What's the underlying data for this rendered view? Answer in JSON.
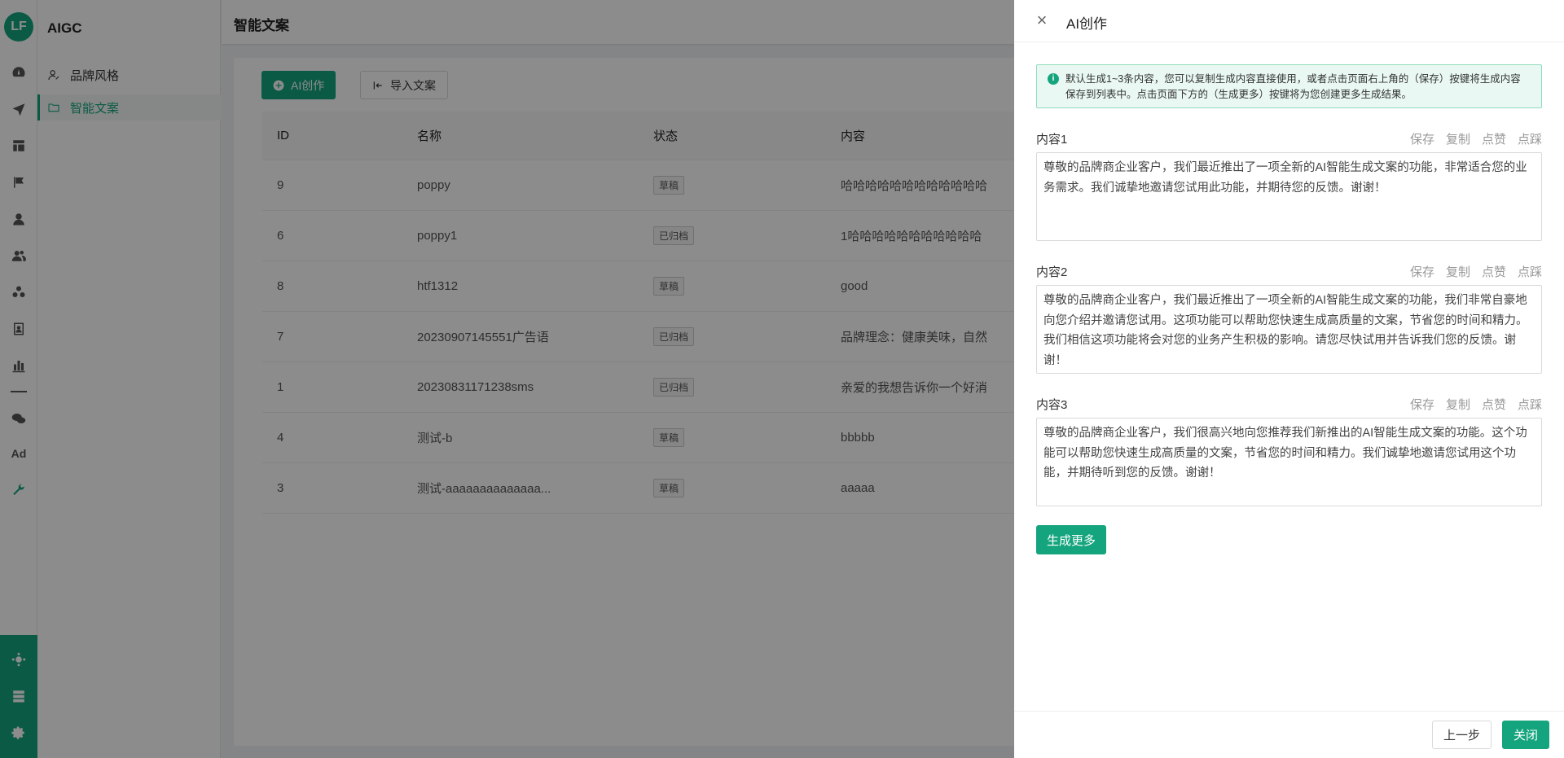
{
  "app": {
    "logo_text": "LF",
    "name": "AIGC"
  },
  "colors": {
    "accent": "#15a57e"
  },
  "rail": {
    "icons": [
      "dashboard-icon",
      "send-icon",
      "layout-icon",
      "flag-icon",
      "user-icon",
      "users-icon",
      "group-icon",
      "contact-icon",
      "bar-chart-icon",
      "link-icon",
      "wechat-icon",
      "ad-icon",
      "wrench-icon"
    ],
    "ad_label": "Ad",
    "bottom_icons": [
      "brain-icon",
      "server-icon",
      "settings-icon"
    ]
  },
  "sidemenu": {
    "items": [
      {
        "label": "品牌风格",
        "icon": "user-style-icon",
        "active": false
      },
      {
        "label": "智能文案",
        "icon": "folder-icon",
        "active": true
      }
    ]
  },
  "page": {
    "title": "智能文案",
    "toolbar": {
      "ai_create_label": "AI创作",
      "import_label": "导入文案"
    }
  },
  "table": {
    "columns": [
      "ID",
      "名称",
      "状态",
      "内容"
    ],
    "rows": [
      {
        "id": "9",
        "name": "poppy",
        "status": "草稿",
        "content": "哈哈哈哈哈哈哈哈哈哈哈哈"
      },
      {
        "id": "6",
        "name": "poppy1",
        "status": "已归档",
        "content": "1哈哈哈哈哈哈哈哈哈哈哈"
      },
      {
        "id": "8",
        "name": "htf1312",
        "status": "草稿",
        "content": "good"
      },
      {
        "id": "7",
        "name": "20230907145551广告语",
        "status": "已归档",
        "content": "品牌理念：健康美味，自然"
      },
      {
        "id": "1",
        "name": "20230831171238sms",
        "status": "已归档",
        "content": "亲爱的我想告诉你一个好消"
      },
      {
        "id": "4",
        "name": "测试-b",
        "status": "草稿",
        "content": "bbbbb"
      },
      {
        "id": "3",
        "name": "测试-aaaaaaaaaaaaaa...",
        "status": "草稿",
        "content": "aaaaa"
      }
    ]
  },
  "drawer": {
    "title": "AI创作",
    "notice": "默认生成1~3条内容，您可以复制生成内容直接使用，或者点击页面右上角的（保存）按键将生成内容保存到列表中。点击页面下方的（生成更多）按键将为您创建更多生成结果。",
    "actions": [
      "保存",
      "复制",
      "点赞",
      "点踩"
    ],
    "contents": [
      {
        "label": "内容1",
        "text": "尊敬的品牌商企业客户，我们最近推出了一项全新的AI智能生成文案的功能，非常适合您的业务需求。我们诚挚地邀请您试用此功能，并期待您的反馈。谢谢！"
      },
      {
        "label": "内容2",
        "text": "尊敬的品牌商企业客户，我们最近推出了一项全新的AI智能生成文案的功能，我们非常自豪地向您介绍并邀请您试用。这项功能可以帮助您快速生成高质量的文案，节省您的时间和精力。我们相信这项功能将会对您的业务产生积极的影响。请您尽快试用并告诉我们您的反馈。谢谢！"
      },
      {
        "label": "内容3",
        "text": "尊敬的品牌商企业客户，我们很高兴地向您推荐我们新推出的AI智能生成文案的功能。这个功能可以帮助您快速生成高质量的文案，节省您的时间和精力。我们诚挚地邀请您试用这个功能，并期待听到您的反馈。谢谢！"
      }
    ],
    "generate_more_label": "生成更多",
    "footer": {
      "prev_label": "上一步",
      "close_label": "关闭"
    }
  }
}
